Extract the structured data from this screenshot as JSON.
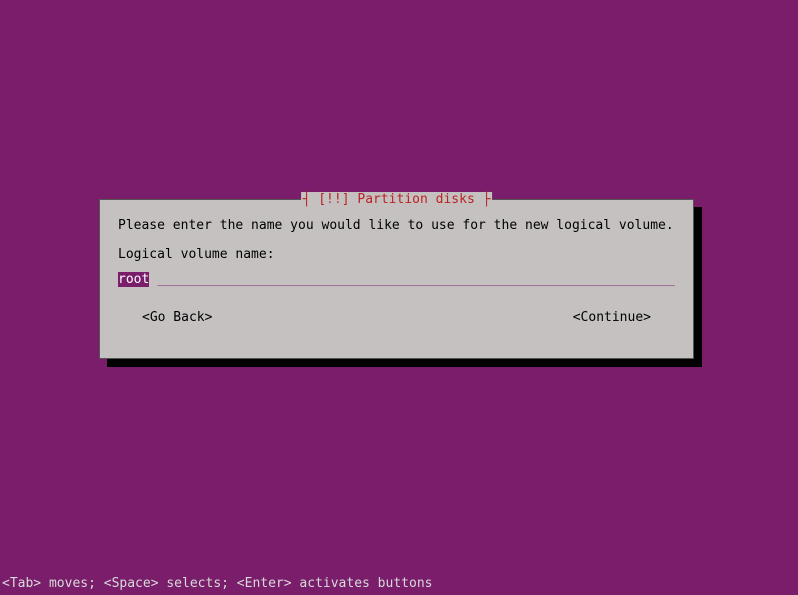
{
  "dialog": {
    "title_decor_left": "┤ ",
    "title_prefix": "[!!] ",
    "title_text": "Partition disks",
    "title_decor_right": " ├",
    "prompt": "Please enter the name you would like to use for the new logical volume.",
    "field_label": "Logical volume name:",
    "input_value": "root",
    "input_fill": "___________________________________________________________________",
    "buttons": {
      "back": "<Go Back>",
      "continue": "<Continue>"
    }
  },
  "footer": {
    "help_text": "<Tab> moves; <Space> selects; <Enter> activates buttons"
  },
  "colors": {
    "background": "#7a1e6c",
    "panel": "#c5c1c1",
    "title_accent": "#b22"
  }
}
